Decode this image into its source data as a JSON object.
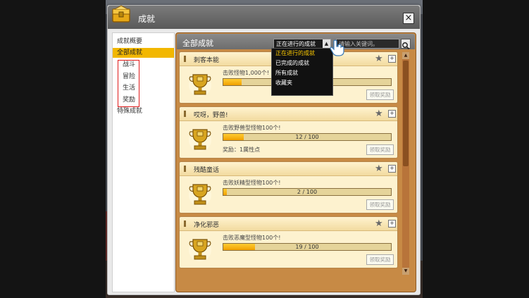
{
  "window": {
    "title": "成就",
    "close_label": "×"
  },
  "sidebar": {
    "items": [
      {
        "label": "成就概要",
        "selected": false
      },
      {
        "label": "全部成就",
        "selected": true
      },
      {
        "label": "战斗",
        "selected": false
      },
      {
        "label": "冒险",
        "selected": false
      },
      {
        "label": "生活",
        "selected": false
      },
      {
        "label": "奖励",
        "selected": false
      },
      {
        "label": "特殊成就",
        "selected": false
      }
    ]
  },
  "main": {
    "header_title": "全部成就",
    "filter": {
      "selected": "正在进行的成就",
      "options": [
        "正在进行的成就",
        "已完成的成就",
        "所有成就",
        "收藏夹"
      ]
    },
    "search": {
      "placeholder": "请输入关键词。"
    }
  },
  "achievements": [
    {
      "title": "刺客本能",
      "desc": "击败怪物1,000个!",
      "progress_text": "",
      "progress": 0.11,
      "reward": "",
      "claim_label": "领取奖励"
    },
    {
      "title": "哎呀，野兽!",
      "desc": "击败野兽型怪物100个!",
      "progress_text": "12 / 100",
      "progress": 0.12,
      "reward": "奖励：1属性点",
      "claim_label": "领取奖励"
    },
    {
      "title": "残酷童话",
      "desc": "击败妖精型怪物100个!",
      "progress_text": "2 / 100",
      "progress": 0.02,
      "reward": "",
      "claim_label": "领取奖励"
    },
    {
      "title": "净化邪恶",
      "desc": "击败恶魔型怪物100个!",
      "progress_text": "19 / 100",
      "progress": 0.19,
      "reward": "",
      "claim_label": "领取奖励"
    }
  ],
  "colors": {
    "accent": "#f2b700",
    "frame": "#c78a45",
    "card_bg": "#fdf2cf",
    "highlight_box": "#e01b1b"
  }
}
